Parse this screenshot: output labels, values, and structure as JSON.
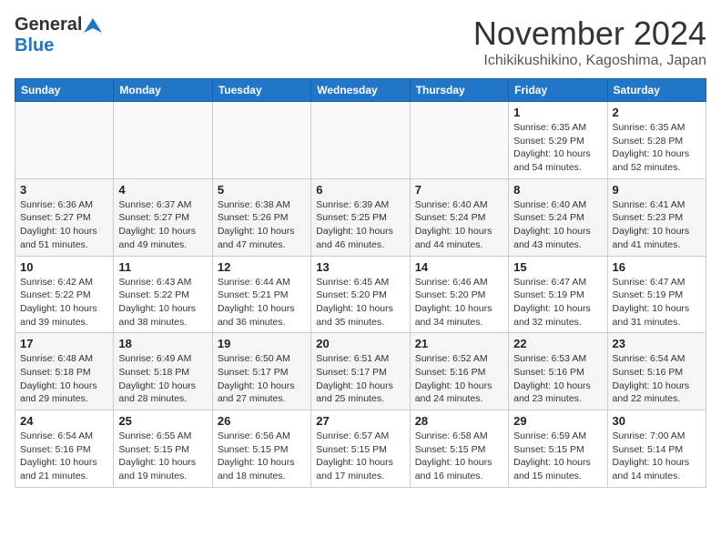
{
  "header": {
    "logo_general": "General",
    "logo_blue": "Blue",
    "month_title": "November 2024",
    "location": "Ichikikushikino, Kagoshima, Japan"
  },
  "days_of_week": [
    "Sunday",
    "Monday",
    "Tuesday",
    "Wednesday",
    "Thursday",
    "Friday",
    "Saturday"
  ],
  "weeks": [
    {
      "days": [
        {
          "num": "",
          "info": ""
        },
        {
          "num": "",
          "info": ""
        },
        {
          "num": "",
          "info": ""
        },
        {
          "num": "",
          "info": ""
        },
        {
          "num": "",
          "info": ""
        },
        {
          "num": "1",
          "info": "Sunrise: 6:35 AM\nSunset: 5:29 PM\nDaylight: 10 hours and 54 minutes."
        },
        {
          "num": "2",
          "info": "Sunrise: 6:35 AM\nSunset: 5:28 PM\nDaylight: 10 hours and 52 minutes."
        }
      ]
    },
    {
      "days": [
        {
          "num": "3",
          "info": "Sunrise: 6:36 AM\nSunset: 5:27 PM\nDaylight: 10 hours and 51 minutes."
        },
        {
          "num": "4",
          "info": "Sunrise: 6:37 AM\nSunset: 5:27 PM\nDaylight: 10 hours and 49 minutes."
        },
        {
          "num": "5",
          "info": "Sunrise: 6:38 AM\nSunset: 5:26 PM\nDaylight: 10 hours and 47 minutes."
        },
        {
          "num": "6",
          "info": "Sunrise: 6:39 AM\nSunset: 5:25 PM\nDaylight: 10 hours and 46 minutes."
        },
        {
          "num": "7",
          "info": "Sunrise: 6:40 AM\nSunset: 5:24 PM\nDaylight: 10 hours and 44 minutes."
        },
        {
          "num": "8",
          "info": "Sunrise: 6:40 AM\nSunset: 5:24 PM\nDaylight: 10 hours and 43 minutes."
        },
        {
          "num": "9",
          "info": "Sunrise: 6:41 AM\nSunset: 5:23 PM\nDaylight: 10 hours and 41 minutes."
        }
      ]
    },
    {
      "days": [
        {
          "num": "10",
          "info": "Sunrise: 6:42 AM\nSunset: 5:22 PM\nDaylight: 10 hours and 39 minutes."
        },
        {
          "num": "11",
          "info": "Sunrise: 6:43 AM\nSunset: 5:22 PM\nDaylight: 10 hours and 38 minutes."
        },
        {
          "num": "12",
          "info": "Sunrise: 6:44 AM\nSunset: 5:21 PM\nDaylight: 10 hours and 36 minutes."
        },
        {
          "num": "13",
          "info": "Sunrise: 6:45 AM\nSunset: 5:20 PM\nDaylight: 10 hours and 35 minutes."
        },
        {
          "num": "14",
          "info": "Sunrise: 6:46 AM\nSunset: 5:20 PM\nDaylight: 10 hours and 34 minutes."
        },
        {
          "num": "15",
          "info": "Sunrise: 6:47 AM\nSunset: 5:19 PM\nDaylight: 10 hours and 32 minutes."
        },
        {
          "num": "16",
          "info": "Sunrise: 6:47 AM\nSunset: 5:19 PM\nDaylight: 10 hours and 31 minutes."
        }
      ]
    },
    {
      "days": [
        {
          "num": "17",
          "info": "Sunrise: 6:48 AM\nSunset: 5:18 PM\nDaylight: 10 hours and 29 minutes."
        },
        {
          "num": "18",
          "info": "Sunrise: 6:49 AM\nSunset: 5:18 PM\nDaylight: 10 hours and 28 minutes."
        },
        {
          "num": "19",
          "info": "Sunrise: 6:50 AM\nSunset: 5:17 PM\nDaylight: 10 hours and 27 minutes."
        },
        {
          "num": "20",
          "info": "Sunrise: 6:51 AM\nSunset: 5:17 PM\nDaylight: 10 hours and 25 minutes."
        },
        {
          "num": "21",
          "info": "Sunrise: 6:52 AM\nSunset: 5:16 PM\nDaylight: 10 hours and 24 minutes."
        },
        {
          "num": "22",
          "info": "Sunrise: 6:53 AM\nSunset: 5:16 PM\nDaylight: 10 hours and 23 minutes."
        },
        {
          "num": "23",
          "info": "Sunrise: 6:54 AM\nSunset: 5:16 PM\nDaylight: 10 hours and 22 minutes."
        }
      ]
    },
    {
      "days": [
        {
          "num": "24",
          "info": "Sunrise: 6:54 AM\nSunset: 5:16 PM\nDaylight: 10 hours and 21 minutes."
        },
        {
          "num": "25",
          "info": "Sunrise: 6:55 AM\nSunset: 5:15 PM\nDaylight: 10 hours and 19 minutes."
        },
        {
          "num": "26",
          "info": "Sunrise: 6:56 AM\nSunset: 5:15 PM\nDaylight: 10 hours and 18 minutes."
        },
        {
          "num": "27",
          "info": "Sunrise: 6:57 AM\nSunset: 5:15 PM\nDaylight: 10 hours and 17 minutes."
        },
        {
          "num": "28",
          "info": "Sunrise: 6:58 AM\nSunset: 5:15 PM\nDaylight: 10 hours and 16 minutes."
        },
        {
          "num": "29",
          "info": "Sunrise: 6:59 AM\nSunset: 5:15 PM\nDaylight: 10 hours and 15 minutes."
        },
        {
          "num": "30",
          "info": "Sunrise: 7:00 AM\nSunset: 5:14 PM\nDaylight: 10 hours and 14 minutes."
        }
      ]
    }
  ]
}
